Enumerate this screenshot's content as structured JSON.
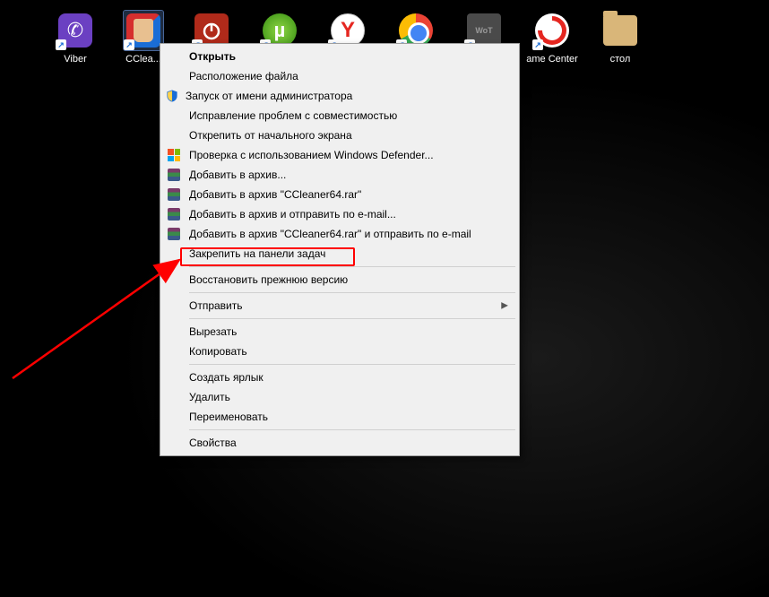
{
  "desktop": {
    "icons": [
      {
        "name": "viber",
        "label": "Viber"
      },
      {
        "name": "ccleaner",
        "label": "CClea..."
      },
      {
        "name": "shutdown",
        "label": ""
      },
      {
        "name": "utorrent",
        "label": ""
      },
      {
        "name": "yandex",
        "label": ""
      },
      {
        "name": "chrome",
        "label": ""
      },
      {
        "name": "wot",
        "label": ""
      },
      {
        "name": "gamecenter",
        "label": "ame Center"
      },
      {
        "name": "folder",
        "label": "стол"
      }
    ]
  },
  "context_menu": {
    "open": "Открыть",
    "file_location": "Расположение файла",
    "run_as_admin": "Запуск от имени администратора",
    "compat_troubleshoot": "Исправление проблем с совместимостью",
    "unpin_start": "Открепить от начального экрана",
    "defender_scan": "Проверка с использованием Windows Defender...",
    "add_to_archive": "Добавить в архив...",
    "add_to_named": "Добавить в архив \"CCleaner64.rar\"",
    "add_and_email": "Добавить в архив и отправить по e-mail...",
    "add_named_and_email": "Добавить в архив \"CCleaner64.rar\" и отправить по e-mail",
    "pin_taskbar": "Закрепить на панели задач",
    "restore_previous": "Восстановить прежнюю версию",
    "send_to": "Отправить",
    "cut": "Вырезать",
    "copy": "Копировать",
    "create_shortcut": "Создать ярлык",
    "delete": "Удалить",
    "rename": "Переименовать",
    "properties": "Свойства"
  }
}
